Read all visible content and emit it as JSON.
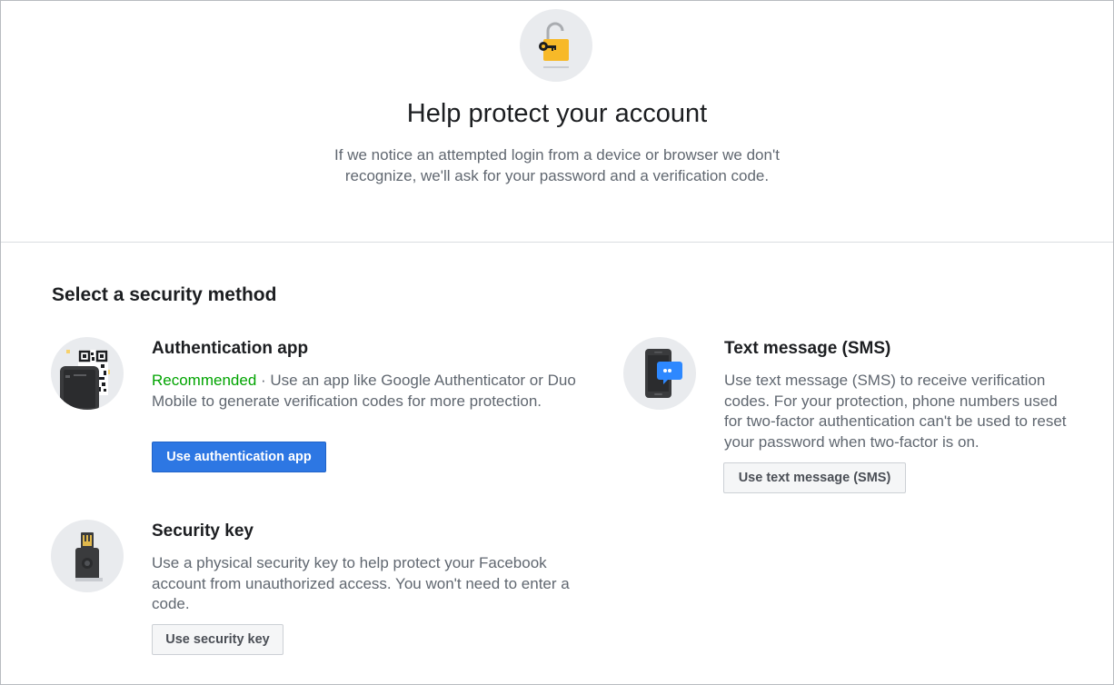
{
  "hero": {
    "icon": "unlocked-padlock-key-icon",
    "title": "Help protect your account",
    "description": "If we notice an attempted login from a device or browser we don't recognize, we'll ask for your password and a verification code."
  },
  "section_title": "Select a security method",
  "methods": {
    "auth_app": {
      "icon": "phone-qr-code-icon",
      "title": "Authentication app",
      "recommended": "Recommended",
      "description": " · Use an app like Google Authenticator or Duo Mobile to generate verification codes for more protection.",
      "button": "Use authentication app"
    },
    "sms": {
      "icon": "phone-chat-bubble-icon",
      "title": "Text message (SMS)",
      "description": "Use text message (SMS) to receive verification codes. For your protection, phone numbers used for two-factor authentication can't be used to reset your password when two-factor is on.",
      "button": "Use text message (SMS)"
    },
    "security_key": {
      "icon": "usb-security-key-icon",
      "title": "Security key",
      "description": "Use a physical security key to help protect your Facebook account from unauthorized access. You won't need to enter a code.",
      "button": "Use security key"
    }
  },
  "colors": {
    "primary_button": "#2d77e3",
    "recommended_green": "#00a400",
    "icon_circle": "#e9ebee"
  }
}
